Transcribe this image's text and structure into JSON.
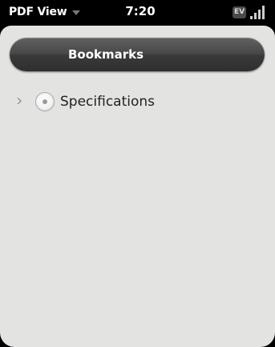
{
  "status_bar": {
    "app_menu_label": "PDF View",
    "time": "7:20",
    "network_badge": "EV",
    "icons": [
      "chevron-down-icon",
      "ev-network-icon",
      "signal-strength-icon"
    ]
  },
  "header": {
    "title": "Bookmarks"
  },
  "bookmarks": {
    "items": [
      {
        "label": "Specifications",
        "icon": "bookmark-icon",
        "expander": "expand-arrow-icon"
      }
    ]
  },
  "colors": {
    "status_bar_bg": "#000000",
    "card_bg": "#e3e3e1",
    "header_bg": "#3a3a3a",
    "header_text": "#ffffff",
    "list_text": "#222222"
  }
}
